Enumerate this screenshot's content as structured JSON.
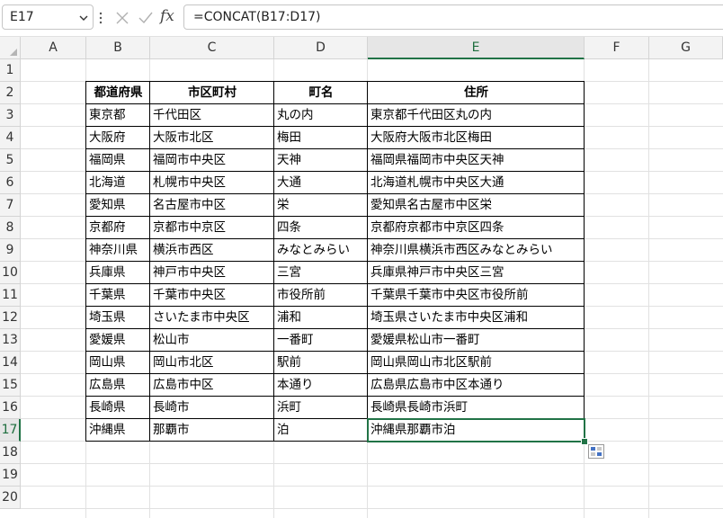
{
  "name_box": "E17",
  "formula": "=CONCAT(B17:D17)",
  "fx_label": "fx",
  "columns": [
    "A",
    "B",
    "C",
    "D",
    "E",
    "F",
    "G"
  ],
  "rows": [
    "1",
    "2",
    "3",
    "4",
    "5",
    "6",
    "7",
    "8",
    "9",
    "10",
    "11",
    "12",
    "13",
    "14",
    "15",
    "16",
    "17",
    "18",
    "19",
    "20"
  ],
  "active_column": "E",
  "active_row": "17",
  "table": {
    "headers": [
      "都道府県",
      "市区町村",
      "町名",
      "住所"
    ],
    "rows": [
      [
        "東京都",
        "千代田区",
        "丸の内",
        "東京都千代田区丸の内"
      ],
      [
        "大阪府",
        "大阪市北区",
        "梅田",
        "大阪府大阪市北区梅田"
      ],
      [
        "福岡県",
        "福岡市中央区",
        "天神",
        "福岡県福岡市中央区天神"
      ],
      [
        "北海道",
        "札幌市中央区",
        "大通",
        "北海道札幌市中央区大通"
      ],
      [
        "愛知県",
        "名古屋市中区",
        "栄",
        "愛知県名古屋市中区栄"
      ],
      [
        "京都府",
        "京都市中京区",
        "四条",
        "京都府京都市中京区四条"
      ],
      [
        "神奈川県",
        "横浜市西区",
        "みなとみらい",
        "神奈川県横浜市西区みなとみらい"
      ],
      [
        "兵庫県",
        "神戸市中央区",
        "三宮",
        "兵庫県神戸市中央区三宮"
      ],
      [
        "千葉県",
        "千葉市中央区",
        "市役所前",
        "千葉県千葉市中央区市役所前"
      ],
      [
        "埼玉県",
        "さいたま市中央区",
        "浦和",
        "埼玉県さいたま市中央区浦和"
      ],
      [
        "愛媛県",
        "松山市",
        "一番町",
        "愛媛県松山市一番町"
      ],
      [
        "岡山県",
        "岡山市北区",
        "駅前",
        "岡山県岡山市北区駅前"
      ],
      [
        "広島県",
        "広島市中区",
        "本通り",
        "広島県広島市中区本通り"
      ],
      [
        "長崎県",
        "長崎市",
        "浜町",
        "長崎県長崎市浜町"
      ],
      [
        "沖縄県",
        "那覇市",
        "泊",
        "沖縄県那覇市泊"
      ]
    ]
  },
  "colors": {
    "accent": "#217346",
    "header_bg": "#f3f3f3",
    "gridline": "#e1e1e1"
  },
  "icons": {
    "name_box_dropdown": "chevron-down-icon",
    "cancel": "close-icon",
    "enter": "check-icon",
    "quick_analysis": "quick-analysis-icon"
  }
}
